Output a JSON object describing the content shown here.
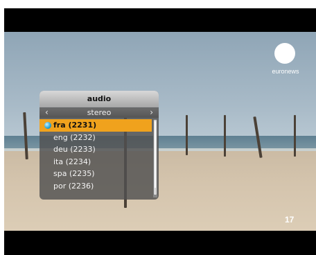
{
  "channel": {
    "logo_text": "euronews",
    "number": "17"
  },
  "audio_menu": {
    "title": "audio",
    "mode": "stereo",
    "items": [
      {
        "label": "fra (2231)",
        "selected": true,
        "icon": "globe-icon"
      },
      {
        "label": "eng (2232)"
      },
      {
        "label": "deu (2233)"
      },
      {
        "label": "ita (2234)"
      },
      {
        "label": "spa (2235)"
      },
      {
        "label": "por (2236)"
      }
    ]
  },
  "colors": {
    "selected_highlight": "#f0a21d",
    "menu_background": "#505050",
    "title_bar": "#c4c4c4"
  }
}
